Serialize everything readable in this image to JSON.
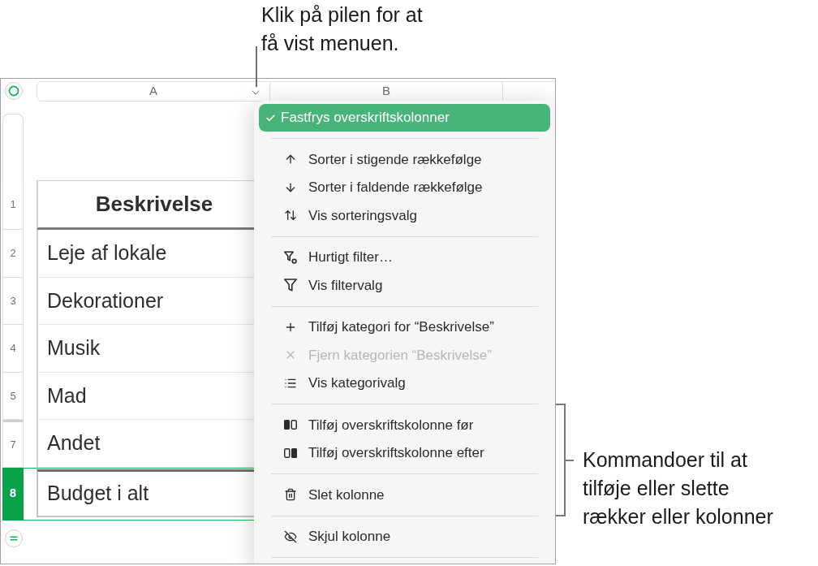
{
  "callouts": [
    {
      "lines": [
        "Klik på pilen for at",
        "få vist menuen."
      ]
    },
    {
      "lines": [
        "Kommandoer til at",
        "tilføje eller slette",
        "rækker eller kolonner"
      ]
    }
  ],
  "columns": [
    {
      "label": "A",
      "menu_open": true
    },
    {
      "label": "B",
      "menu_open": false
    }
  ],
  "rows": [
    {
      "number": "1",
      "kind": "header",
      "text": "Beskrivelse",
      "selected": false,
      "follows_hidden_row": false
    },
    {
      "number": "2",
      "kind": "body",
      "text": "Leje af lokale",
      "selected": false,
      "follows_hidden_row": false
    },
    {
      "number": "3",
      "kind": "body",
      "text": "Dekorationer",
      "selected": false,
      "follows_hidden_row": false
    },
    {
      "number": "4",
      "kind": "body",
      "text": "Musik",
      "selected": false,
      "follows_hidden_row": false
    },
    {
      "number": "5",
      "kind": "body",
      "text": "Mad",
      "selected": false,
      "follows_hidden_row": false
    },
    {
      "number": "7",
      "kind": "body",
      "text": "Andet",
      "selected": false,
      "follows_hidden_row": true
    },
    {
      "number": "8",
      "kind": "footer",
      "text": "Budget i alt",
      "selected": true,
      "follows_hidden_row": false
    }
  ],
  "menu": {
    "groups": [
      {
        "items": [
          {
            "label": "Fastfrys overskriftskolonner",
            "selected": true,
            "checked": true,
            "disabled": false
          }
        ]
      },
      {
        "items": [
          {
            "label": "Sorter i stigende rækkefølge",
            "selected": false,
            "checked": false,
            "disabled": false
          },
          {
            "label": "Sorter i faldende rækkefølge",
            "selected": false,
            "checked": false,
            "disabled": false
          },
          {
            "label": "Vis sorteringsvalg",
            "selected": false,
            "checked": false,
            "disabled": false
          }
        ]
      },
      {
        "items": [
          {
            "label": "Hurtigt filter…",
            "selected": false,
            "checked": false,
            "disabled": false
          },
          {
            "label": "Vis filtervalg",
            "selected": false,
            "checked": false,
            "disabled": false
          }
        ]
      },
      {
        "items": [
          {
            "label": "Tilføj kategori for “Beskrivelse”",
            "selected": false,
            "checked": false,
            "disabled": false
          },
          {
            "label": "Fjern kategorien “Beskrivelse”",
            "selected": false,
            "checked": false,
            "disabled": true
          },
          {
            "label": "Vis kategorivalg",
            "selected": false,
            "checked": false,
            "disabled": false
          }
        ]
      },
      {
        "items": [
          {
            "label": "Tilføj overskriftskolonne før",
            "selected": false,
            "checked": false,
            "disabled": false
          },
          {
            "label": "Tilføj overskriftskolonne efter",
            "selected": false,
            "checked": false,
            "disabled": false
          }
        ]
      },
      {
        "items": [
          {
            "label": "Slet kolonne",
            "selected": false,
            "checked": false,
            "disabled": false
          }
        ]
      },
      {
        "items": [
          {
            "label": "Skjul kolonne",
            "selected": false,
            "checked": false,
            "disabled": false
          }
        ]
      }
    ]
  }
}
